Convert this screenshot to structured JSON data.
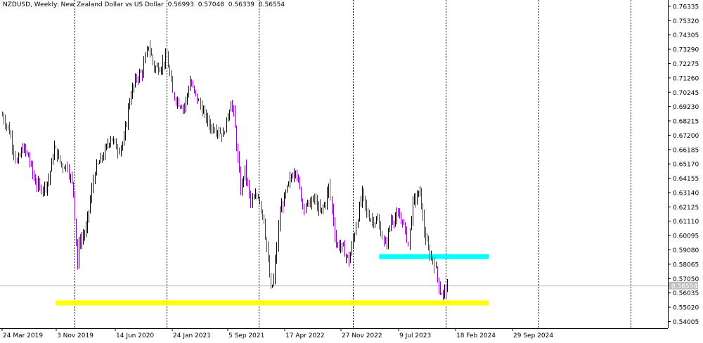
{
  "header": {
    "symbol": "NZDUSD, Weekly: New Zealand Dollar vs US Dollar",
    "open": "0.56993",
    "high": "0.57048",
    "low": "0.56339",
    "close": "0.56554"
  },
  "chart_data": {
    "type": "candlestick",
    "symbol": "NZDUSD",
    "timeframe": "Weekly",
    "ylim": [
      0.5353,
      0.7678
    ],
    "y_ticks": [
      0.76335,
      0.7532,
      0.74305,
      0.7329,
      0.72275,
      0.7126,
      0.70245,
      0.6923,
      0.68215,
      0.672,
      0.66185,
      0.6517,
      0.64155,
      0.6314,
      0.62125,
      0.6111,
      0.60095,
      0.5908,
      0.58065,
      0.5705,
      0.56035,
      0.5502,
      0.54005
    ],
    "y_tick_labels": [
      "0.76335",
      "0.75320",
      "0.74305",
      "0.73290",
      "0.72275",
      "0.71260",
      "0.70245",
      "0.69230",
      "0.68215",
      "0.67200",
      "0.66185",
      "0.65170",
      "0.64155",
      "0.63140",
      "0.62125",
      "0.61110",
      "0.60095",
      "0.59080",
      "0.58065",
      "0.57050",
      "0.56035",
      "0.55020",
      "0.54005"
    ],
    "x_tick_labels": [
      "24 Mar 2019",
      "3 Nov 2019",
      "14 Jun 2020",
      "24 Jan 2021",
      "5 Sep 2021",
      "17 Apr 2022",
      "27 Nov 2022",
      "9 Jul 2023",
      "18 Feb 2024",
      "29 Sep 2024"
    ],
    "current_price": 0.56554,
    "current_price_label": "0.56554",
    "colors": {
      "up": "#000000",
      "down": "#9400d3",
      "grid": "#000000",
      "price_line": "#c0c0c0",
      "support_zone": "#ffff00",
      "resistance_zone": "#00ffff"
    },
    "zones": [
      {
        "name": "cyan zone",
        "color": "#00ffff",
        "from_date": "2024-03-17",
        "to_date": "2025-08-31",
        "y_top": 0.5878,
        "y_bottom": 0.586
      },
      {
        "name": "yellow zone",
        "color": "#ffff00",
        "from_date": "2019-12-01",
        "to_date": "2025-08-31",
        "y_top": 0.555,
        "y_bottom": 0.553
      }
    ],
    "path_keypoints": [
      [
        "2019-03-17",
        0.686
      ],
      [
        "2019-04-21",
        0.675
      ],
      [
        "2019-05-26",
        0.652
      ],
      [
        "2019-06-23",
        0.663
      ],
      [
        "2019-07-21",
        0.657
      ],
      [
        "2019-08-18",
        0.641
      ],
      [
        "2019-09-15",
        0.634
      ],
      [
        "2019-10-13",
        0.637
      ],
      [
        "2019-10-27",
        0.641
      ],
      [
        "2019-11-24",
        0.663
      ],
      [
        "2019-12-29",
        0.651
      ],
      [
        "2020-01-26",
        0.65
      ],
      [
        "2020-02-23",
        0.633
      ],
      [
        "2020-03-15",
        0.58
      ],
      [
        "2020-03-22",
        0.595
      ],
      [
        "2020-04-26",
        0.605
      ],
      [
        "2020-06-07",
        0.647
      ],
      [
        "2020-07-19",
        0.658
      ],
      [
        "2020-08-23",
        0.671
      ],
      [
        "2020-09-27",
        0.662
      ],
      [
        "2020-10-25",
        0.668
      ],
      [
        "2020-11-22",
        0.698
      ],
      [
        "2020-12-27",
        0.713
      ],
      [
        "2021-01-24",
        0.717
      ],
      [
        "2021-02-21",
        0.736
      ],
      [
        "2021-03-21",
        0.72
      ],
      [
        "2021-04-18",
        0.72
      ],
      [
        "2021-05-23",
        0.728
      ],
      [
        "2021-06-20",
        0.701
      ],
      [
        "2021-07-18",
        0.695
      ],
      [
        "2021-08-15",
        0.692
      ],
      [
        "2021-09-12",
        0.71
      ],
      [
        "2021-10-10",
        0.7
      ],
      [
        "2021-11-14",
        0.688
      ],
      [
        "2021-12-19",
        0.678
      ],
      [
        "2022-01-16",
        0.677
      ],
      [
        "2022-02-20",
        0.672
      ],
      [
        "2022-03-27",
        0.696
      ],
      [
        "2022-04-10",
        0.687
      ],
      [
        "2022-05-15",
        0.633
      ],
      [
        "2022-06-05",
        0.648
      ],
      [
        "2022-07-03",
        0.624
      ],
      [
        "2022-08-07",
        0.63
      ],
      [
        "2022-09-04",
        0.612
      ],
      [
        "2022-10-09",
        0.562
      ],
      [
        "2022-10-23",
        0.57
      ],
      [
        "2022-11-20",
        0.618
      ],
      [
        "2023-01-08",
        0.64
      ],
      [
        "2023-02-05",
        0.649
      ],
      [
        "2023-03-12",
        0.623
      ],
      [
        "2023-04-09",
        0.623
      ],
      [
        "2023-05-07",
        0.627
      ],
      [
        "2023-06-04",
        0.617
      ],
      [
        "2023-07-02",
        0.625
      ],
      [
        "2023-07-16",
        0.636
      ],
      [
        "2023-08-20",
        0.595
      ],
      [
        "2023-09-17",
        0.593
      ],
      [
        "2023-10-22",
        0.583
      ],
      [
        "2023-11-12",
        0.598
      ],
      [
        "2023-12-24",
        0.631
      ],
      [
        "2024-01-14",
        0.617
      ],
      [
        "2024-02-11",
        0.612
      ],
      [
        "2024-03-10",
        0.611
      ],
      [
        "2024-04-14",
        0.593
      ],
      [
        "2024-05-12",
        0.612
      ],
      [
        "2024-06-09",
        0.614
      ],
      [
        "2024-07-07",
        0.612
      ],
      [
        "2024-08-04",
        0.595
      ],
      [
        "2024-08-25",
        0.624
      ],
      [
        "2024-09-29",
        0.632
      ],
      [
        "2024-10-20",
        0.604
      ],
      [
        "2024-11-10",
        0.59
      ],
      [
        "2024-12-08",
        0.581
      ],
      [
        "2025-01-05",
        0.561
      ],
      [
        "2025-01-19",
        0.56
      ],
      [
        "2025-02-09",
        0.565
      ]
    ]
  }
}
